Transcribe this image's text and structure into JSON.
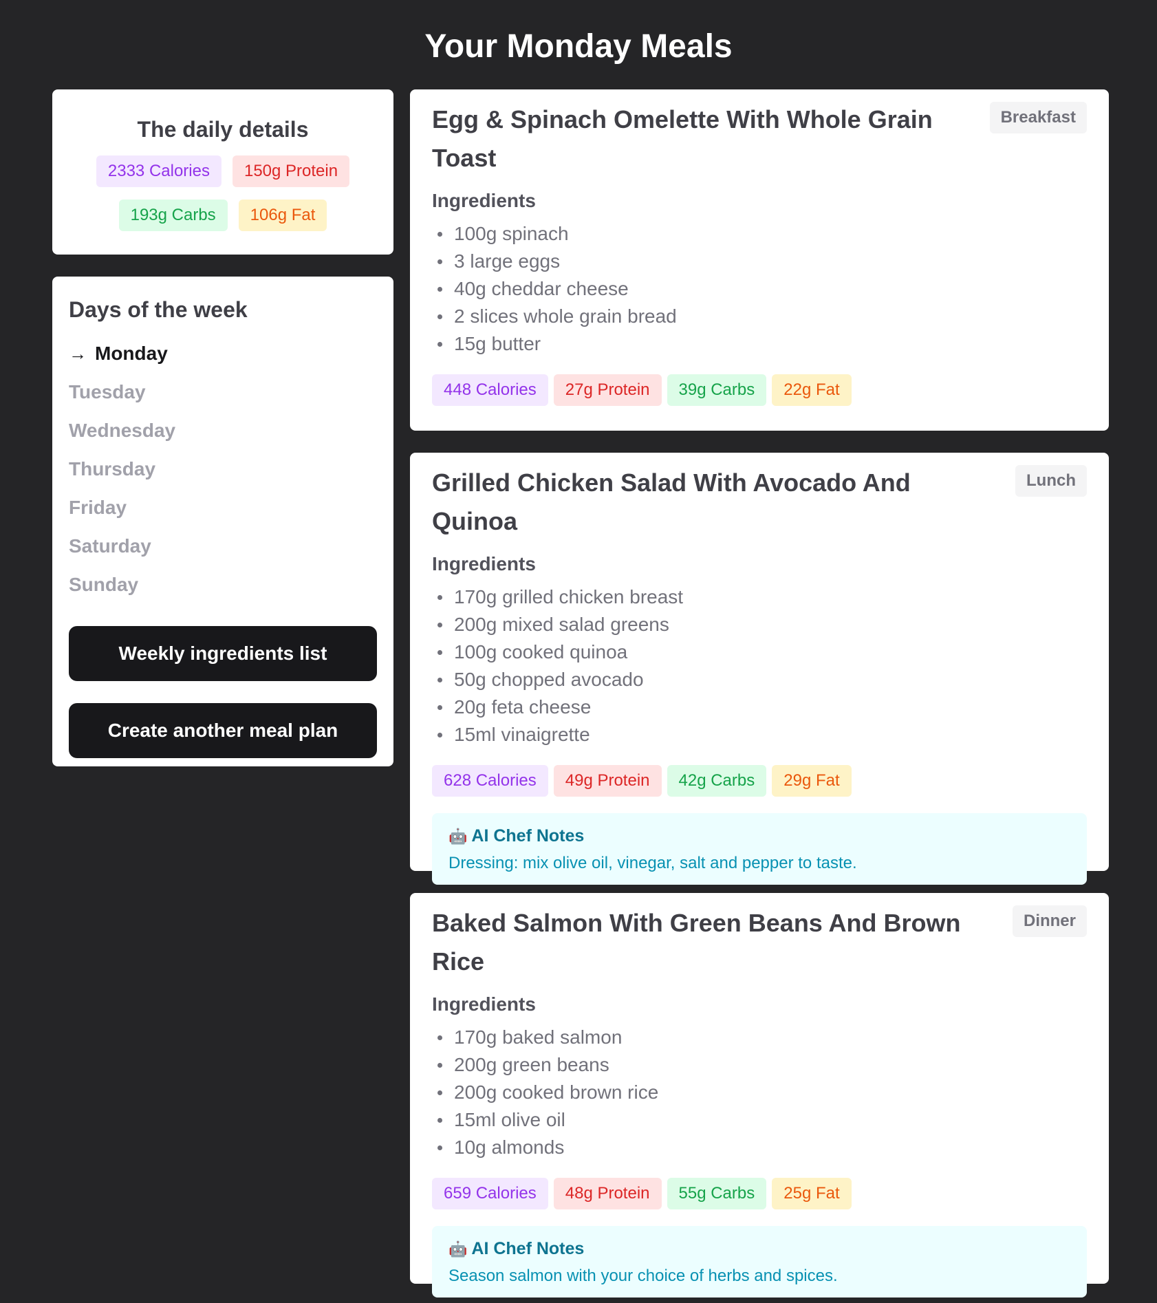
{
  "page": {
    "title": "Your Monday Meals"
  },
  "daily": {
    "title": "The daily details",
    "calories": "2333 Calories",
    "protein": "150g Protein",
    "carbs": "193g Carbs",
    "fat": "106g Fat"
  },
  "days": {
    "title": "Days of the week",
    "active_marker": "→",
    "items": [
      "Monday",
      "Tuesday",
      "Wednesday",
      "Thursday",
      "Friday",
      "Saturday",
      "Sunday"
    ],
    "active": "Monday"
  },
  "actions": {
    "weekly_ingredients": "Weekly ingredients list",
    "create_plan": "Create another meal plan"
  },
  "meals": [
    {
      "title": "Egg & Spinach Omelette With Whole Grain Toast",
      "tag": "Breakfast",
      "ingredients_heading": "Ingredients",
      "ingredients": [
        "100g spinach",
        "3 large eggs",
        "40g cheddar cheese",
        "2 slices whole grain bread",
        "15g butter"
      ],
      "calories": "448 Calories",
      "protein": "27g Protein",
      "carbs": "39g Carbs",
      "fat": "22g Fat"
    },
    {
      "title": "Grilled Chicken Salad With Avocado And Quinoa",
      "tag": "Lunch",
      "ingredients_heading": "Ingredients",
      "ingredients": [
        "170g grilled chicken breast",
        "200g mixed salad greens",
        "100g cooked quinoa",
        "50g chopped avocado",
        "20g feta cheese",
        "15ml vinaigrette"
      ],
      "calories": "628 Calories",
      "protein": "49g Protein",
      "carbs": "42g Carbs",
      "fat": "29g Fat",
      "notes_heading": "AI Chef Notes",
      "notes": "Dressing: mix olive oil, vinegar, salt and pepper to taste."
    },
    {
      "title": "Baked Salmon With Green Beans And Brown Rice",
      "tag": "Dinner",
      "ingredients_heading": "Ingredients",
      "ingredients": [
        "170g baked salmon",
        "200g green beans",
        "200g cooked brown rice",
        "15ml olive oil",
        "10g almonds"
      ],
      "calories": "659 Calories",
      "protein": "48g Protein",
      "carbs": "55g Carbs",
      "fat": "25g Fat",
      "notes_heading": "AI Chef Notes",
      "notes": "Season salmon with your choice of herbs and spices."
    }
  ],
  "icons": {
    "active_day": "arrow-right-icon",
    "chef": "robot-chef-icon"
  }
}
